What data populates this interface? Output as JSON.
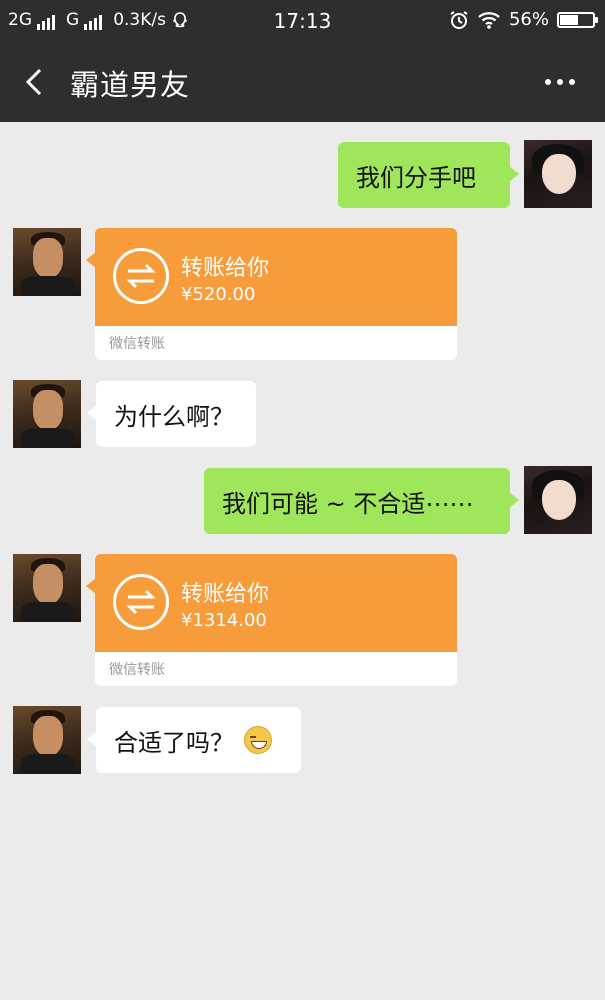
{
  "status_bar": {
    "sim1": "2G",
    "sim2": "G",
    "speed": "0.3K/s",
    "time": "17:13",
    "battery": "56%",
    "battery_level": 0.56
  },
  "header": {
    "title": "霸道男友",
    "back_icon": "chevron-left-icon",
    "more_icon": "more-dots-icon"
  },
  "messages": [
    {
      "side": "right",
      "type": "text",
      "text": "我们分手吧"
    },
    {
      "side": "left",
      "type": "transfer",
      "title": "转账给你",
      "amount": "¥520.00",
      "source": "微信转账"
    },
    {
      "side": "left",
      "type": "text",
      "text": "为什么啊？"
    },
    {
      "side": "right",
      "type": "text",
      "text": "我们可能 ~ 不合适⋯⋯"
    },
    {
      "side": "left",
      "type": "transfer",
      "title": "转账给你",
      "amount": "¥1314.00",
      "source": "微信转账"
    },
    {
      "side": "left",
      "type": "text",
      "text": "合适了吗？",
      "emoji": "grin-emoji"
    }
  ],
  "colors": {
    "header_bg": "#2e2e2e",
    "chat_bg": "#ebebeb",
    "my_bubble": "#9fe65a",
    "their_bubble": "#ffffff",
    "transfer": "#f79c3a"
  }
}
